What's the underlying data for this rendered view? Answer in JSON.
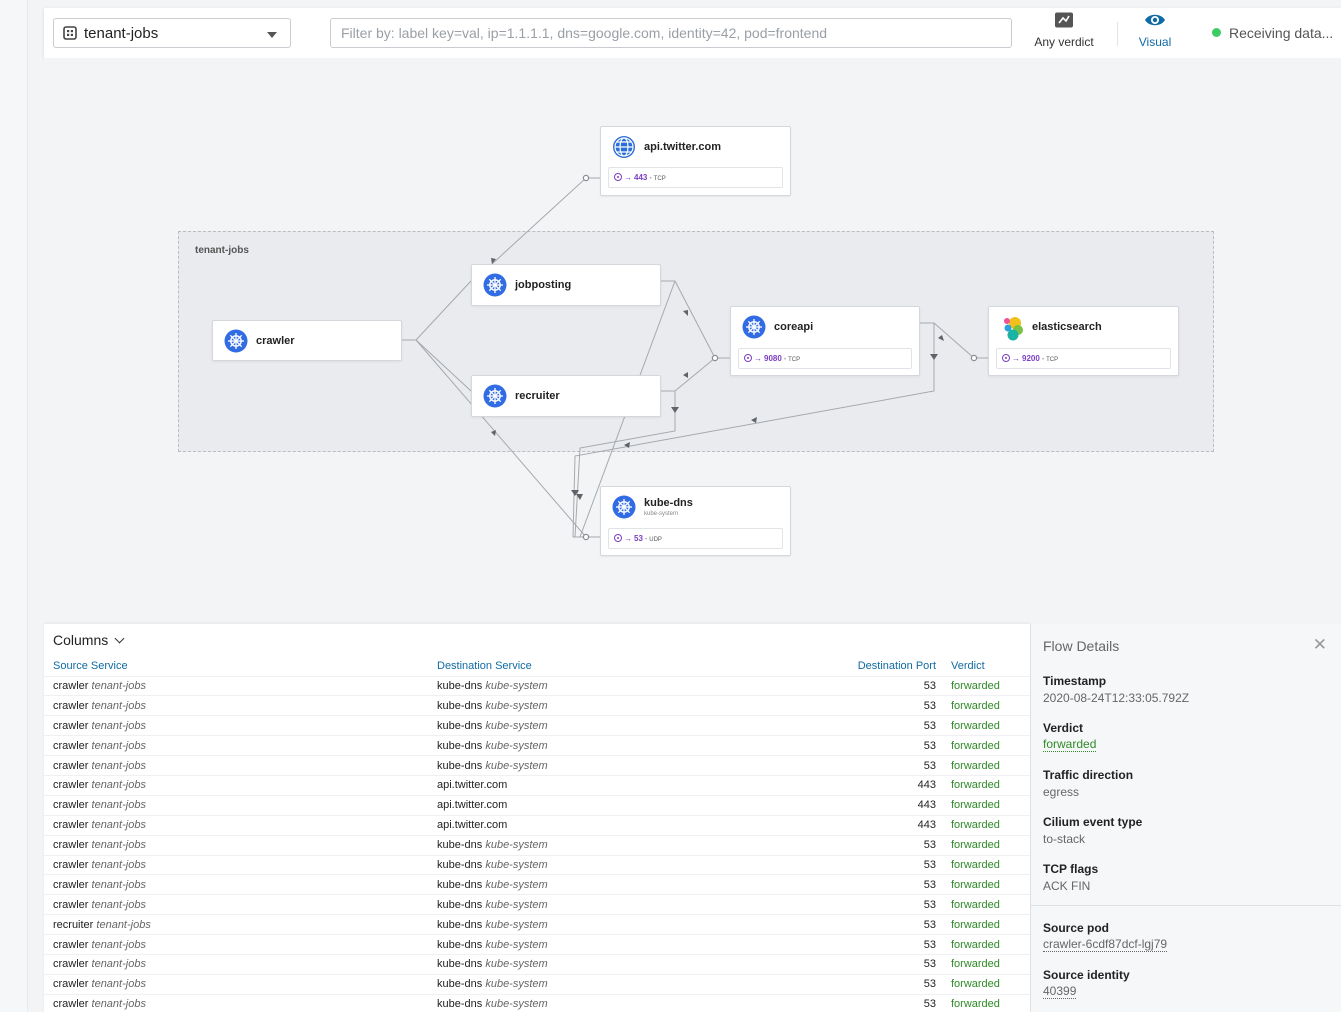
{
  "toolbar": {
    "namespace": "tenant-jobs",
    "filter_placeholder": "Filter by: label key=val, ip=1.1.1.1, dns=google.com, identity=42, pod=frontend",
    "verdict_label": "Any verdict",
    "visual_label": "Visual",
    "status": "Receiving data..."
  },
  "graph": {
    "namespace_box_label": "tenant-jobs",
    "nodes": {
      "api_twitter": {
        "title": "api.twitter.com",
        "port": "443",
        "protocol": "TCP"
      },
      "jobposting": {
        "title": "jobposting"
      },
      "crawler": {
        "title": "crawler"
      },
      "recruiter": {
        "title": "recruiter"
      },
      "coreapi": {
        "title": "coreapi",
        "port": "9080",
        "protocol": "TCP"
      },
      "elasticsearch": {
        "title": "elasticsearch",
        "port": "9200",
        "protocol": "TCP"
      },
      "kube_dns": {
        "title": "kube-dns",
        "subtitle": "kube-system",
        "port": "53",
        "protocol": "UDP"
      }
    }
  },
  "table": {
    "columns_label": "Columns",
    "headers": [
      "Source Service",
      "Destination Service",
      "Destination Port",
      "Verdict"
    ],
    "rows": [
      {
        "src": "crawler",
        "src_ns": "tenant-jobs",
        "dst": "kube-dns",
        "dst_ns": "kube-system",
        "port": "53",
        "verdict": "forwarded"
      },
      {
        "src": "crawler",
        "src_ns": "tenant-jobs",
        "dst": "kube-dns",
        "dst_ns": "kube-system",
        "port": "53",
        "verdict": "forwarded"
      },
      {
        "src": "crawler",
        "src_ns": "tenant-jobs",
        "dst": "kube-dns",
        "dst_ns": "kube-system",
        "port": "53",
        "verdict": "forwarded"
      },
      {
        "src": "crawler",
        "src_ns": "tenant-jobs",
        "dst": "kube-dns",
        "dst_ns": "kube-system",
        "port": "53",
        "verdict": "forwarded"
      },
      {
        "src": "crawler",
        "src_ns": "tenant-jobs",
        "dst": "kube-dns",
        "dst_ns": "kube-system",
        "port": "53",
        "verdict": "forwarded"
      },
      {
        "src": "crawler",
        "src_ns": "tenant-jobs",
        "dst": "api.twitter.com",
        "dst_ns": "",
        "port": "443",
        "verdict": "forwarded"
      },
      {
        "src": "crawler",
        "src_ns": "tenant-jobs",
        "dst": "api.twitter.com",
        "dst_ns": "",
        "port": "443",
        "verdict": "forwarded"
      },
      {
        "src": "crawler",
        "src_ns": "tenant-jobs",
        "dst": "api.twitter.com",
        "dst_ns": "",
        "port": "443",
        "verdict": "forwarded"
      },
      {
        "src": "crawler",
        "src_ns": "tenant-jobs",
        "dst": "kube-dns",
        "dst_ns": "kube-system",
        "port": "53",
        "verdict": "forwarded"
      },
      {
        "src": "crawler",
        "src_ns": "tenant-jobs",
        "dst": "kube-dns",
        "dst_ns": "kube-system",
        "port": "53",
        "verdict": "forwarded"
      },
      {
        "src": "crawler",
        "src_ns": "tenant-jobs",
        "dst": "kube-dns",
        "dst_ns": "kube-system",
        "port": "53",
        "verdict": "forwarded"
      },
      {
        "src": "crawler",
        "src_ns": "tenant-jobs",
        "dst": "kube-dns",
        "dst_ns": "kube-system",
        "port": "53",
        "verdict": "forwarded"
      },
      {
        "src": "recruiter",
        "src_ns": "tenant-jobs",
        "dst": "kube-dns",
        "dst_ns": "kube-system",
        "port": "53",
        "verdict": "forwarded"
      },
      {
        "src": "crawler",
        "src_ns": "tenant-jobs",
        "dst": "kube-dns",
        "dst_ns": "kube-system",
        "port": "53",
        "verdict": "forwarded"
      },
      {
        "src": "crawler",
        "src_ns": "tenant-jobs",
        "dst": "kube-dns",
        "dst_ns": "kube-system",
        "port": "53",
        "verdict": "forwarded"
      },
      {
        "src": "crawler",
        "src_ns": "tenant-jobs",
        "dst": "kube-dns",
        "dst_ns": "kube-system",
        "port": "53",
        "verdict": "forwarded"
      },
      {
        "src": "crawler",
        "src_ns": "tenant-jobs",
        "dst": "kube-dns",
        "dst_ns": "kube-system",
        "port": "53",
        "verdict": "forwarded"
      }
    ]
  },
  "details": {
    "title": "Flow Details",
    "timestamp_label": "Timestamp",
    "timestamp": "2020-08-24T12:33:05.792Z",
    "verdict_label": "Verdict",
    "verdict": "forwarded",
    "direction_label": "Traffic direction",
    "direction": "egress",
    "event_type_label": "Cilium event type",
    "event_type": "to-stack",
    "tcp_flags_label": "TCP flags",
    "tcp_flags": "ACK FIN",
    "source_pod_label": "Source pod",
    "source_pod": "crawler-6cdf87dcf-lgj79",
    "source_identity_label": "Source identity",
    "source_identity": "40399"
  },
  "colors": {
    "accent": "#106ba3",
    "k8s_blue": "#326ce5",
    "port_purple": "#7b3fc4",
    "forwarded_green": "#2e8b26",
    "status_green": "#3dcc61"
  }
}
